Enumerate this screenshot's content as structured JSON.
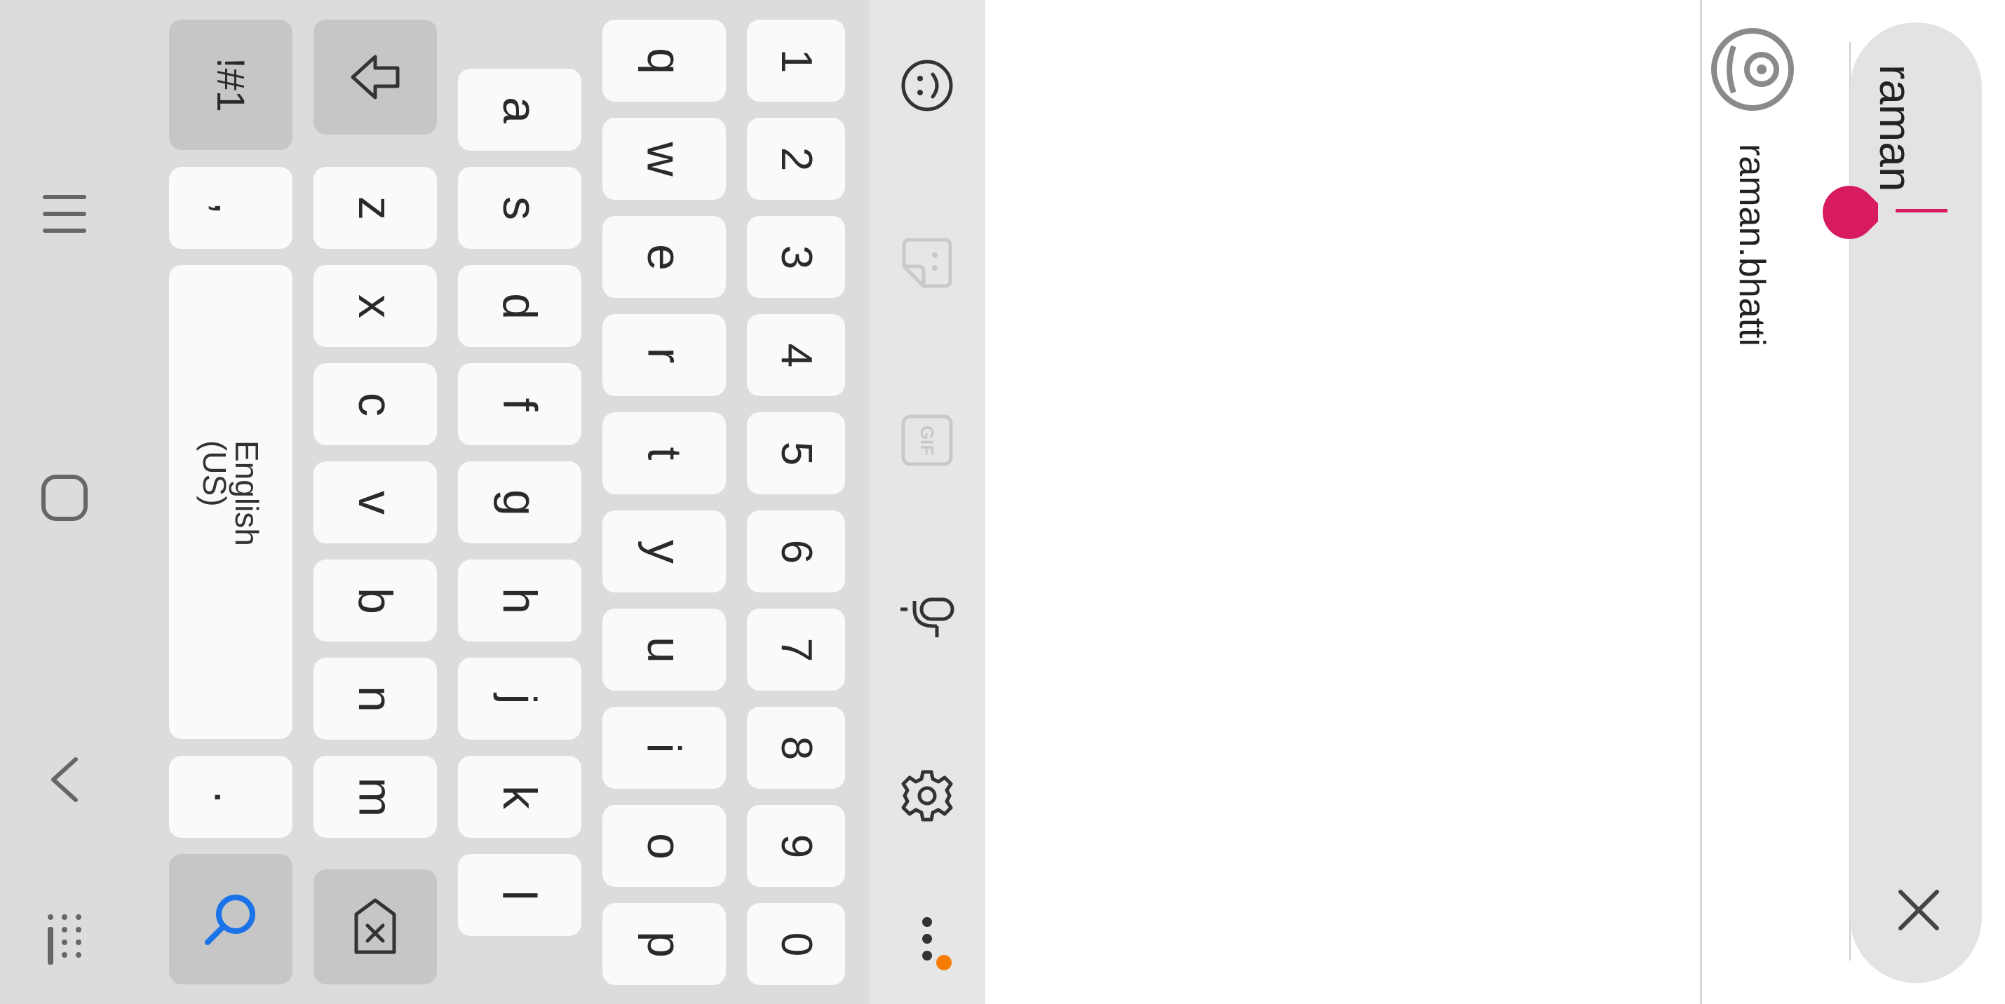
{
  "search": {
    "query": "raman"
  },
  "result": {
    "username": "raman.bhatti",
    "icon": "avatar-icon"
  },
  "keyboard": {
    "language_label": "English (US)",
    "symbols_label": "!#1",
    "comma_label": ",",
    "period_label": ".",
    "number_row": [
      "1",
      "2",
      "3",
      "4",
      "5",
      "6",
      "7",
      "8",
      "9",
      "0"
    ],
    "top_row": [
      "q",
      "w",
      "e",
      "r",
      "t",
      "y",
      "u",
      "i",
      "o",
      "p"
    ],
    "home_row": [
      "a",
      "s",
      "d",
      "f",
      "g",
      "h",
      "j",
      "k",
      "l"
    ],
    "bottom_row": [
      "z",
      "x",
      "c",
      "v",
      "b",
      "n",
      "m"
    ],
    "toolbar_icons": [
      "emoji-icon",
      "sticker-icon",
      "gif-icon",
      "microphone-icon",
      "gear-icon",
      "more-options-icon"
    ],
    "toolbar_gif_label": "GIF"
  },
  "nav_bar": {
    "icons": [
      "recent-apps-icon",
      "home-icon",
      "back-icon",
      "keyboard-switch-icon"
    ]
  },
  "colors": {
    "accent": "#d81b60",
    "search_key": "#1a73e8",
    "notification_dot": "#f57c00",
    "keyboard_bg": "#dcdcdc",
    "key_bg": "#fafafa"
  }
}
